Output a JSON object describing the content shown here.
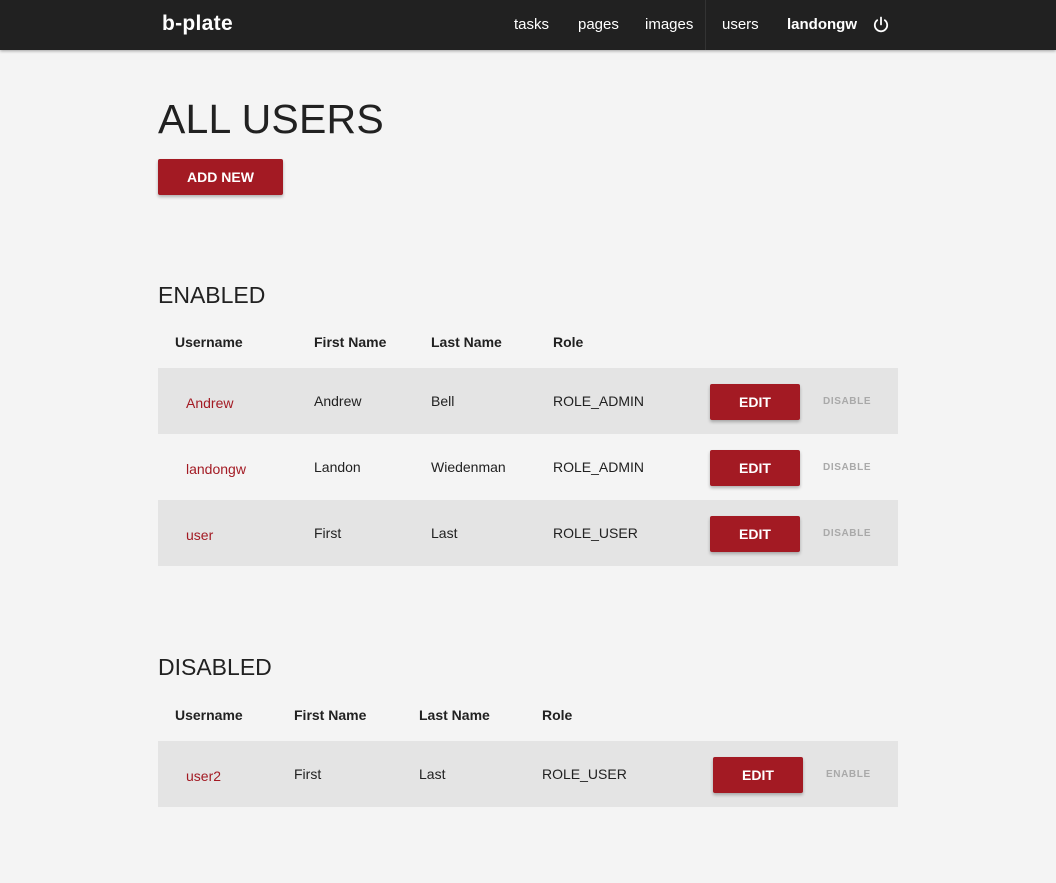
{
  "nav": {
    "brand": "b-plate",
    "links": [
      "tasks",
      "pages",
      "images",
      "users"
    ],
    "current_user": "landongw",
    "logout_icon": "power-icon"
  },
  "page": {
    "title": "ALL USERS",
    "add_button": "ADD NEW"
  },
  "colors": {
    "navbar": "#212121",
    "accent": "#a31a23",
    "background": "#f4f4f4",
    "row_shade": "#e4e4e4",
    "muted": "#a9a9a9"
  },
  "enabled": {
    "title": "ENABLED",
    "headers": [
      "Username",
      "First Name",
      "Last Name",
      "Role"
    ],
    "rows": [
      {
        "username": "Andrew",
        "first": "Andrew",
        "last": "Bell",
        "role": "ROLE_ADMIN",
        "edit": "EDIT",
        "toggle": "DISABLE"
      },
      {
        "username": "landongw",
        "first": "Landon",
        "last": "Wiedenman",
        "role": "ROLE_ADMIN",
        "edit": "EDIT",
        "toggle": "DISABLE"
      },
      {
        "username": "user",
        "first": "First",
        "last": "Last",
        "role": "ROLE_USER",
        "edit": "EDIT",
        "toggle": "DISABLE"
      }
    ]
  },
  "disabled": {
    "title": "DISABLED",
    "headers": [
      "Username",
      "First Name",
      "Last Name",
      "Role"
    ],
    "rows": [
      {
        "username": "user2",
        "first": "First",
        "last": "Last",
        "role": "ROLE_USER",
        "edit": "EDIT",
        "toggle": "ENABLE"
      }
    ]
  }
}
